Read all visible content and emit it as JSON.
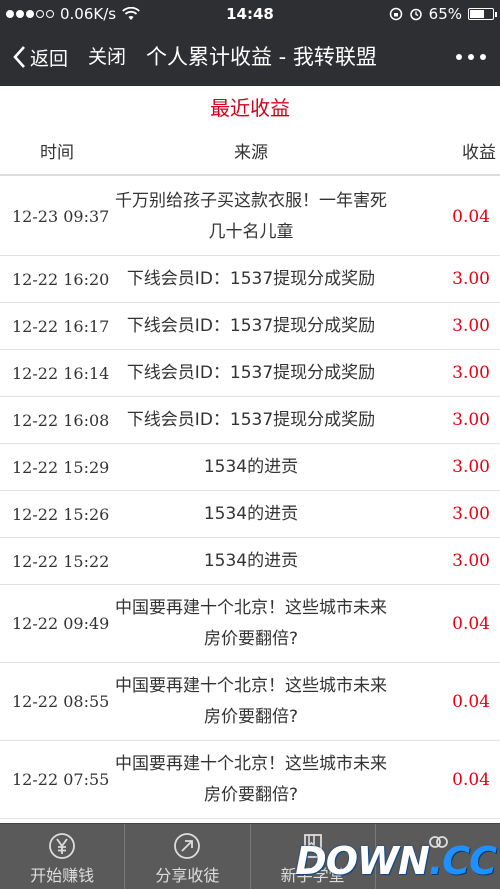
{
  "status_bar": {
    "speed": "0.06K/s",
    "time": "14:48",
    "battery": "65%",
    "battery_level": 0.65
  },
  "nav": {
    "back_label": "返回",
    "close_label": "关闭",
    "title": "个人累计收益 - 我转联盟"
  },
  "section_title": "最近收益",
  "table": {
    "headers": {
      "time": "时间",
      "source": "来源",
      "gain": "收益"
    },
    "rows": [
      {
        "time": "12-23 09:37",
        "source": "千万别给孩子买这款衣服！一年害死几十名儿童",
        "gain": "0.04",
        "tall": true
      },
      {
        "time": "12-22 16:20",
        "source": "下线会员ID：1537提现分成奖励",
        "gain": "3.00",
        "tall": false
      },
      {
        "time": "12-22 16:17",
        "source": "下线会员ID：1537提现分成奖励",
        "gain": "3.00",
        "tall": false
      },
      {
        "time": "12-22 16:14",
        "source": "下线会员ID：1537提现分成奖励",
        "gain": "3.00",
        "tall": false
      },
      {
        "time": "12-22 16:08",
        "source": "下线会员ID：1537提现分成奖励",
        "gain": "3.00",
        "tall": false
      },
      {
        "time": "12-22 15:29",
        "source": "1534的进贡",
        "gain": "3.00",
        "tall": false
      },
      {
        "time": "12-22 15:26",
        "source": "1534的进贡",
        "gain": "3.00",
        "tall": false
      },
      {
        "time": "12-22 15:22",
        "source": "1534的进贡",
        "gain": "3.00",
        "tall": false
      },
      {
        "time": "12-22 09:49",
        "source": "中国要再建十个北京！这些城市未来房价要翻倍?",
        "gain": "0.04",
        "tall": true
      },
      {
        "time": "12-22 08:55",
        "source": "中国要再建十个北京！这些城市未来房价要翻倍?",
        "gain": "0.04",
        "tall": true
      },
      {
        "time": "12-22 07:55",
        "source": "中国要再建十个北京！这些城市未来房价要翻倍?",
        "gain": "0.04",
        "tall": true
      }
    ]
  },
  "tabs": [
    {
      "label": "开始赚钱",
      "icon": "yen-icon"
    },
    {
      "label": "分享收徒",
      "icon": "share-arrow-icon"
    },
    {
      "label": "新手学堂",
      "icon": "book-icon"
    },
    {
      "label": "",
      "icon": "users-icon"
    }
  ],
  "watermark": {
    "part1": "DOWN",
    "part2": ".CC"
  }
}
